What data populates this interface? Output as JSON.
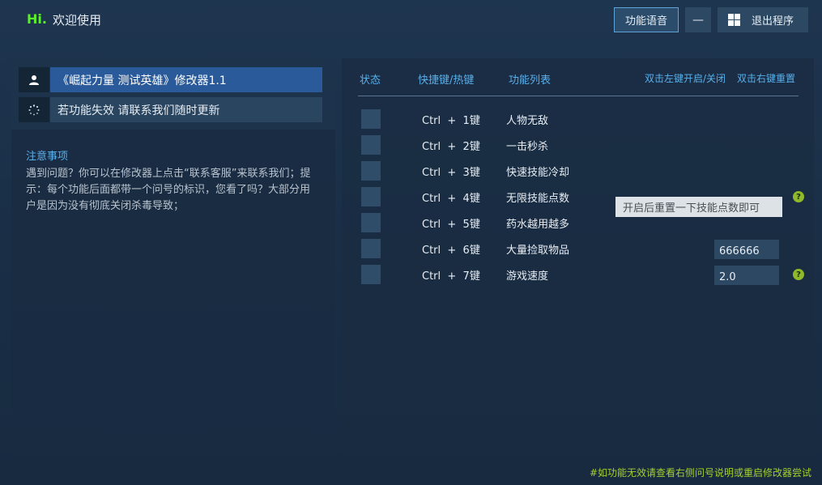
{
  "header": {
    "hi": "Hi.",
    "welcome": "欢迎使用",
    "voice_button": "功能语音",
    "minimize_button": "—",
    "exit_button": "退出程序"
  },
  "sidebar": {
    "items": [
      {
        "label": "《崛起力量 测试英雄》修改器1.1",
        "icon": "user-icon"
      },
      {
        "label": "若功能失效  请联系我们随时更新",
        "icon": "spinner-icon"
      }
    ],
    "notice_title": "注意事项",
    "notice_body": "遇到问题？你可以在修改器上点击“联系客服”来联系我们；提示：每个功能后面都带一个问号的标识，您看了吗？大部分用户是因为没有彻底关闭杀毒导致；"
  },
  "table": {
    "headers": {
      "status": "状态",
      "hotkey": "快捷键/热键",
      "features": "功能列表",
      "toggle_hint": "双击左键开启/关闭",
      "reset_hint": "双击右键重置"
    },
    "rows": [
      {
        "hotkey": "Ctrl  +  1键",
        "name": "人物无敌"
      },
      {
        "hotkey": "Ctrl  +  2键",
        "name": "一击秒杀"
      },
      {
        "hotkey": "Ctrl  +  3键",
        "name": "快速技能冷却"
      },
      {
        "hotkey": "Ctrl  +  4键",
        "name": "无限技能点数"
      },
      {
        "hotkey": "Ctrl  +  5键",
        "name": "药水越用越多"
      },
      {
        "hotkey": "Ctrl  +  6键",
        "name": "大量捡取物品",
        "value": "666666"
      },
      {
        "hotkey": "Ctrl  +  7键",
        "name": "游戏速度",
        "value": "2.0"
      }
    ]
  },
  "tooltip": "开启后重置一下技能点数即可",
  "help_mark": "?",
  "footer": "#如功能无效请查看右侧问号说明或重启修改器尝试",
  "colors": {
    "accent_blue": "#58b0ec",
    "hi_green": "#5af02a",
    "footer_green": "#a5cf2e",
    "active_row": "#2a5a99"
  }
}
